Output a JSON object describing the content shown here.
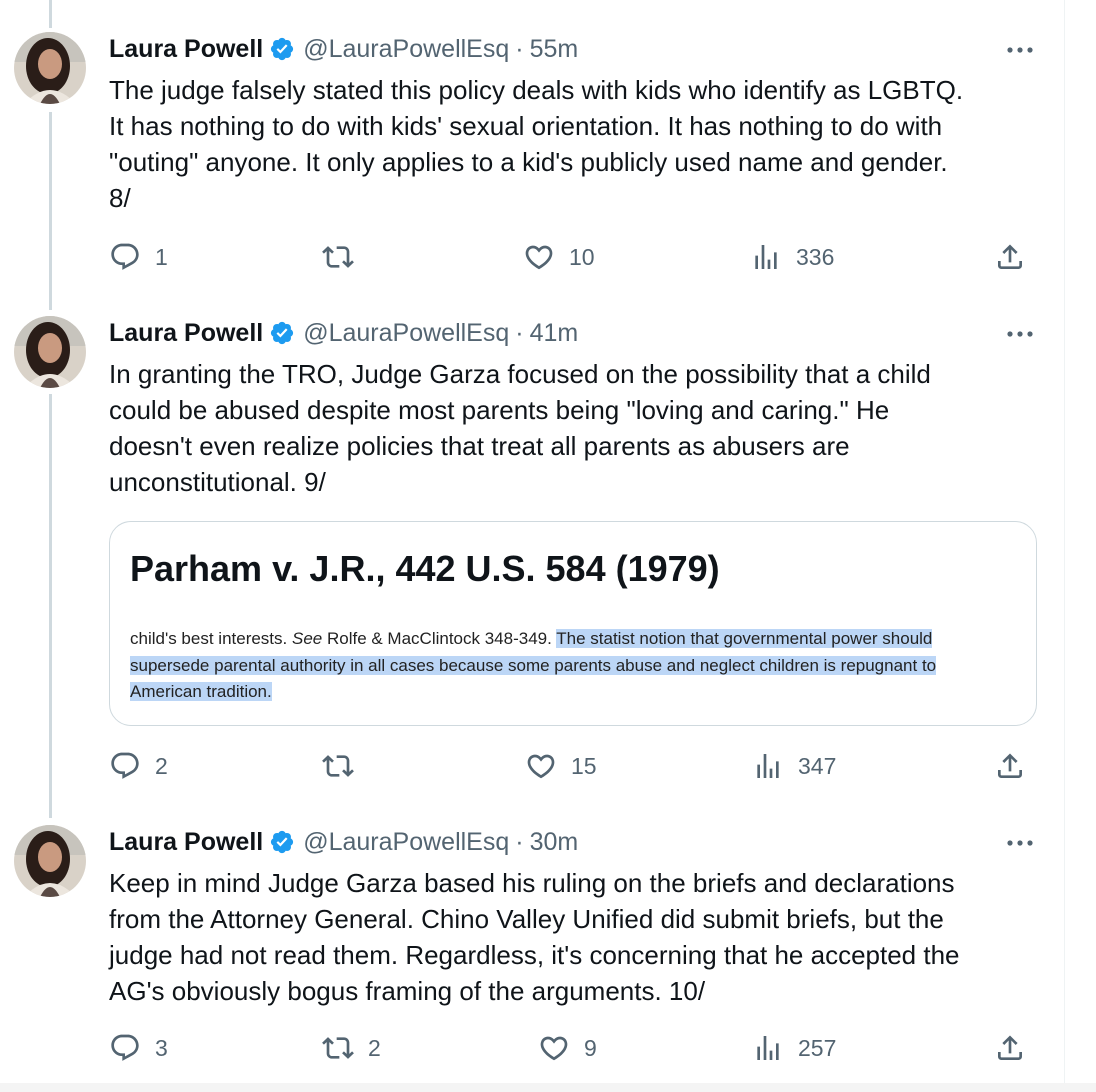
{
  "tweets": [
    {
      "author": {
        "name": "Laura Powell",
        "handle": "@LauraPowellEsq"
      },
      "separator": "·",
      "time": "55m",
      "lines": [
        "The judge falsely stated this policy deals with kids who identify as LGBTQ.",
        "It has nothing to do with kids' sexual orientation. It has nothing to do with",
        "\"outing\" anyone. It only applies to a kid's publicly used name and gender.",
        "8/"
      ],
      "stats": {
        "replies": "1",
        "reposts": "",
        "likes": "10",
        "views": "336"
      }
    },
    {
      "author": {
        "name": "Laura Powell",
        "handle": "@LauraPowellEsq"
      },
      "separator": "·",
      "time": "41m",
      "lines": [
        "In granting the TRO, Judge Garza focused on the possibility that a child",
        "could be abused despite most parents being \"loving and caring.\" He",
        "doesn't even realize policies that treat all parents as abusers are",
        "unconstitutional. 9/"
      ],
      "card": {
        "title": "Parham v. J.R., 442 U.S. 584 (1979)",
        "text_before": "child's best interests. ",
        "text_italic": "See",
        "text_mid": " Rolfe & MacClintock 348-349. ",
        "text_highlight_1": "The statist notion that governmental power should",
        "text_highlight_2": "supersede parental authority in all cases because some parents abuse and neglect children is repugnant to",
        "text_highlight_3": "American tradition."
      },
      "stats": {
        "replies": "2",
        "reposts": "",
        "likes": "15",
        "views": "347"
      }
    },
    {
      "author": {
        "name": "Laura Powell",
        "handle": "@LauraPowellEsq"
      },
      "separator": "·",
      "time": "30m",
      "lines": [
        "Keep in mind Judge Garza based his ruling on the briefs and declarations",
        "from the Attorney General. Chino Valley Unified did submit briefs, but the",
        "judge had not read them. Regardless, it's concerning that he accepted the",
        "AG's obviously bogus framing of the arguments. 10/"
      ],
      "stats": {
        "replies": "3",
        "reposts": "2",
        "likes": "9",
        "views": "257"
      }
    }
  ],
  "icons": {
    "verified": "verified-badge-icon",
    "more": "more-horizontal-icon",
    "reply": "reply-icon",
    "repost": "repost-icon",
    "like": "like-icon",
    "views": "views-icon",
    "share": "share-icon"
  },
  "colors": {
    "verified": "#1d9bf0",
    "text": "#0f1419",
    "secondary": "#536471",
    "highlight": "#bcd6f6",
    "thread_line": "#cfd9de"
  }
}
